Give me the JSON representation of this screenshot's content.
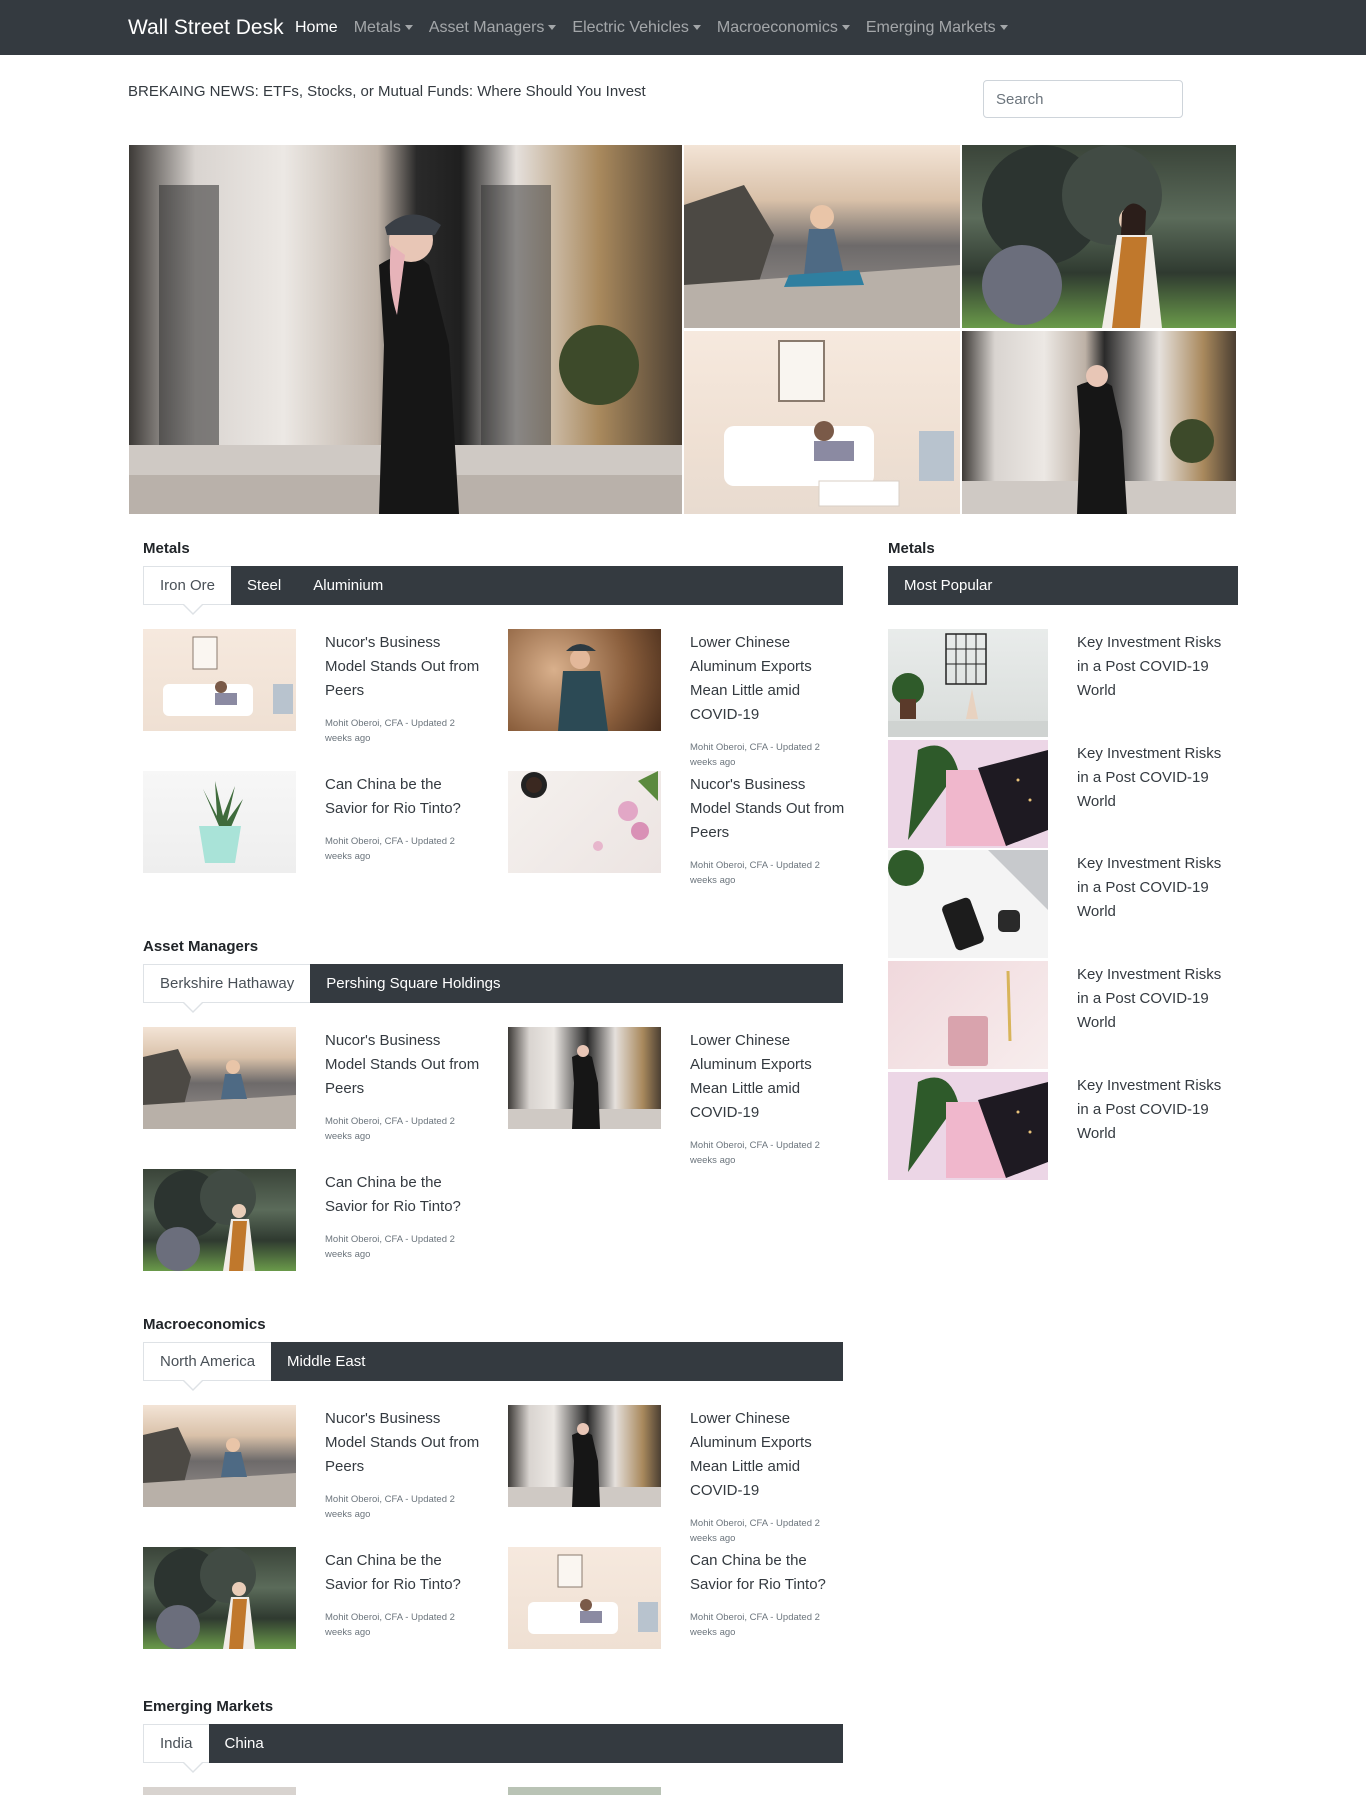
{
  "brand": "Wall Street Desk",
  "nav": [
    {
      "label": "Home",
      "active": true,
      "dropdown": false
    },
    {
      "label": "Metals",
      "active": false,
      "dropdown": true
    },
    {
      "label": "Asset Managers",
      "active": false,
      "dropdown": true
    },
    {
      "label": "Electric Vehicles",
      "active": false,
      "dropdown": true
    },
    {
      "label": "Macroeconomics",
      "active": false,
      "dropdown": true
    },
    {
      "label": "Emerging Markets",
      "active": false,
      "dropdown": true
    }
  ],
  "breaking": "BREKAING NEWS: ETFs, Stocks, or Mutual Funds: Where Should You Invest",
  "search": {
    "placeholder": "Search"
  },
  "colors": {
    "navbar": "#343a40",
    "tab_bar": "#343a40",
    "text": "#343a40"
  },
  "sections": [
    {
      "title": "Metals",
      "tabs": [
        "Iron Ore",
        "Steel",
        "Aluminium"
      ],
      "cards": [
        {
          "title": "Nucor's Business Model Stands Out from Peers",
          "meta": "Mohit Oberoi, CFA - Updated 2 weeks ago",
          "image": "living-room-photo"
        },
        {
          "title": "Lower Chinese Aluminum Exports Mean Little amid COVID-19",
          "meta": "Mohit Oberoi, CFA - Updated 2 weeks ago",
          "image": "woman-in-field-photo"
        },
        {
          "title": "Can China be the Savior for Rio Tinto?",
          "meta": "Mohit Oberoi, CFA - Updated 2 weeks ago",
          "image": "succulent-pot-photo"
        },
        {
          "title": "Nucor's Business Model Stands Out from Peers",
          "meta": "Mohit Oberoi, CFA - Updated 2 weeks ago",
          "image": "coffee-flowers-photo"
        }
      ]
    },
    {
      "title": "Asset Managers",
      "tabs": [
        "Berkshire Hathaway",
        "Pershing Square Holdings"
      ],
      "cards": [
        {
          "title": "Nucor's Business Model Stands Out from Peers",
          "meta": "Mohit Oberoi, CFA - Updated 2 weeks ago",
          "image": "woman-on-cliff-photo"
        },
        {
          "title": "Lower Chinese Aluminum Exports Mean Little amid COVID-19",
          "meta": "Mohit Oberoi, CFA - Updated 2 weeks ago",
          "image": "woman-by-building-photo"
        },
        {
          "title": "Can China be the Savior for Rio Tinto?",
          "meta": "Mohit Oberoi, CFA - Updated 2 weeks ago",
          "image": "woman-by-bush-photo"
        }
      ]
    },
    {
      "title": "Macroeconomics",
      "tabs": [
        "North America",
        "Middle East"
      ],
      "cards": [
        {
          "title": "Nucor's Business Model Stands Out from Peers",
          "meta": "Mohit Oberoi, CFA - Updated 2 weeks ago",
          "image": "woman-on-cliff-photo"
        },
        {
          "title": "Lower Chinese Aluminum Exports Mean Little amid COVID-19",
          "meta": "Mohit Oberoi, CFA - Updated 2 weeks ago",
          "image": "woman-by-building-photo"
        },
        {
          "title": "Can China be the Savior for Rio Tinto?",
          "meta": "Mohit Oberoi, CFA - Updated 2 weeks ago",
          "image": "woman-by-bush-photo"
        },
        {
          "title": "Can China be the Savior for Rio Tinto?",
          "meta": "Mohit Oberoi, CFA - Updated 2 weeks ago",
          "image": "living-room-photo"
        }
      ]
    },
    {
      "title": "Emerging Markets",
      "tabs": [
        "India",
        "China"
      ],
      "cards": []
    }
  ],
  "sidebar": {
    "title": "Metals",
    "tab": "Most Popular",
    "items": [
      {
        "title": "Key Investment Risks in a Post COVID-19 World",
        "image": "desk-plant-photo"
      },
      {
        "title": "Key Investment Risks in a Post COVID-19 World",
        "image": "pink-notebook-leaf-photo"
      },
      {
        "title": "Key Investment Risks in a Post COVID-19 World",
        "image": "laptop-phone-photo"
      },
      {
        "title": "Key Investment Risks in a Post COVID-19 World",
        "image": "pink-notebook-fur-photo"
      },
      {
        "title": "Key Investment Risks in a Post COVID-19 World",
        "image": "pink-notebook-leaf-photo"
      }
    ]
  }
}
